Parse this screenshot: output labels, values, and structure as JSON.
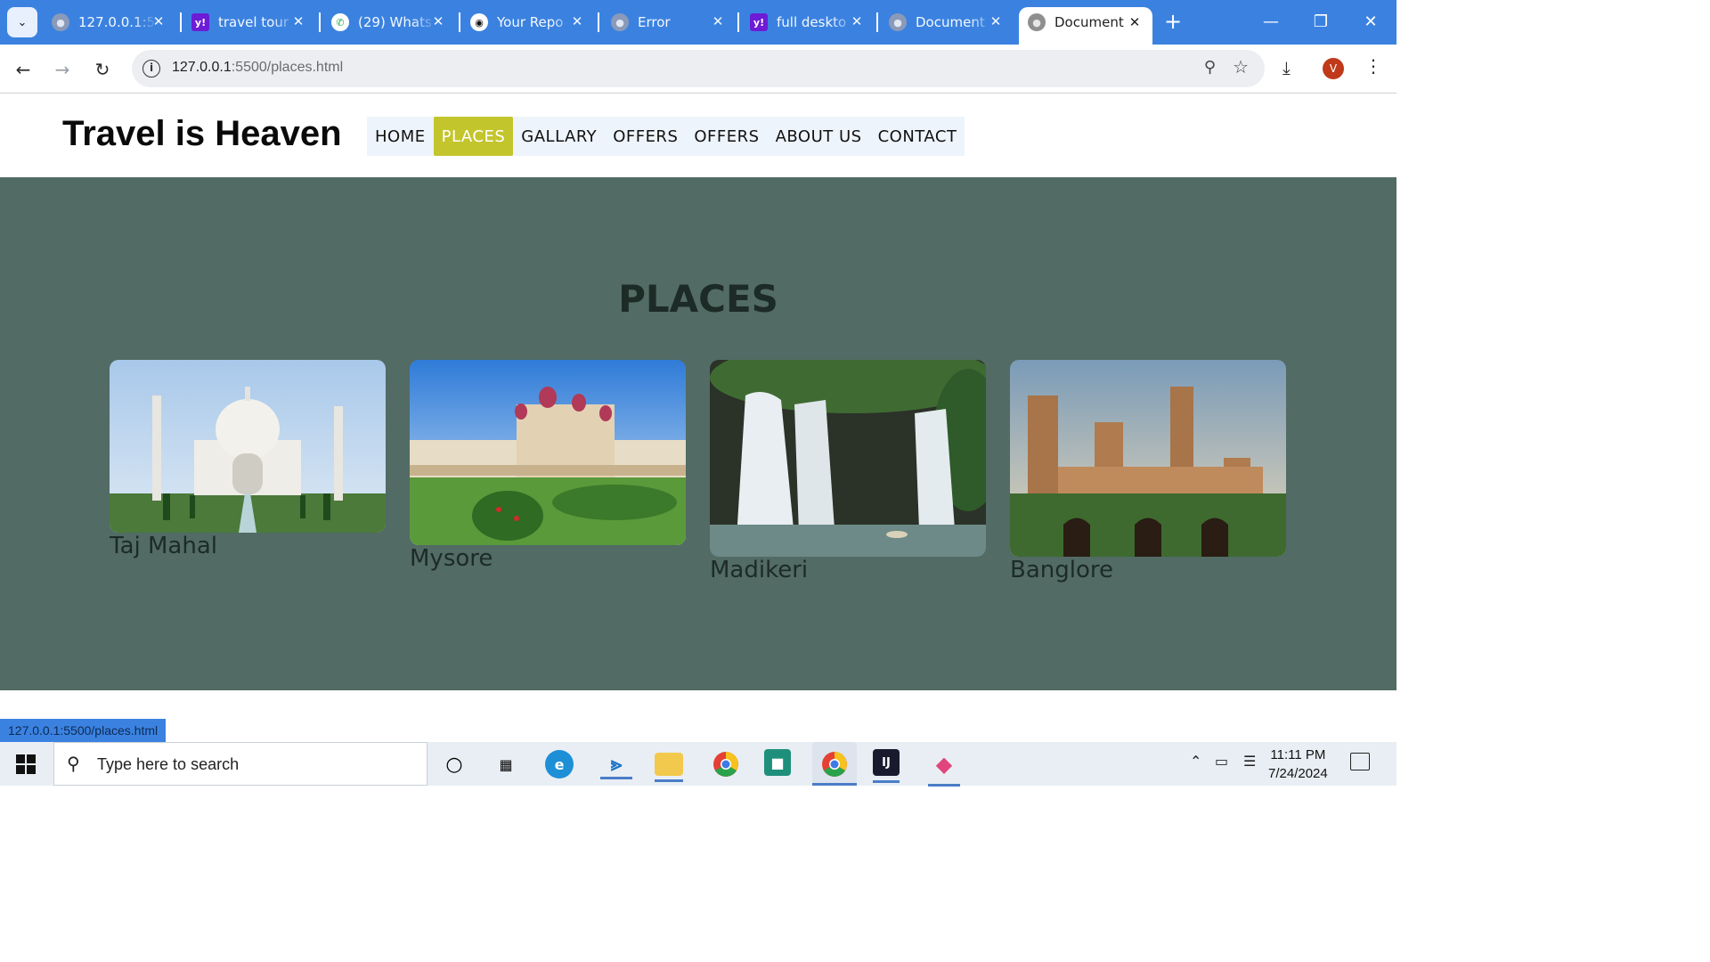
{
  "browser": {
    "tabs": [
      {
        "title": "127.0.0.1:5",
        "favicon": "globe-icon",
        "active": false
      },
      {
        "title": "travel tour",
        "favicon": "yahoo-icon",
        "active": false
      },
      {
        "title": "(29) Whats",
        "favicon": "whatsapp-icon",
        "active": false
      },
      {
        "title": "Your Repo",
        "favicon": "github-icon",
        "active": false
      },
      {
        "title": "Error",
        "favicon": "globe-icon",
        "active": false
      },
      {
        "title": "full deskto",
        "favicon": "yahoo-icon",
        "active": false
      },
      {
        "title": "Document",
        "favicon": "globe-icon",
        "active": false
      },
      {
        "title": "Document",
        "favicon": "globe-icon",
        "active": true
      }
    ],
    "url_host": "127.0.0.1",
    "url_rest": ":5500/places.html",
    "profile_initial": "V",
    "status_url": "127.0.0.1:5500/places.html"
  },
  "site": {
    "logo": "Travel is Heaven",
    "nav": [
      {
        "label": "HOME",
        "active": false
      },
      {
        "label": "PLACES",
        "active": true
      },
      {
        "label": "GALLARY",
        "active": false
      },
      {
        "label": "OFFERS",
        "active": false
      },
      {
        "label": "OFFERS",
        "active": false
      },
      {
        "label": "ABOUT US",
        "active": false
      },
      {
        "label": "CONTACT",
        "active": false
      }
    ],
    "section_title": "PLACES",
    "places": [
      {
        "name": "Taj Mahal"
      },
      {
        "name": "Mysore"
      },
      {
        "name": "Madikeri"
      },
      {
        "name": "Banglore"
      }
    ]
  },
  "taskbar": {
    "search_placeholder": "Type here to search",
    "time": "11:11 PM",
    "date": "7/24/2024"
  },
  "colors": {
    "section_bg": "#526b64",
    "nav_active": "#c3c52c",
    "tab_strip": "#3b82e0"
  }
}
